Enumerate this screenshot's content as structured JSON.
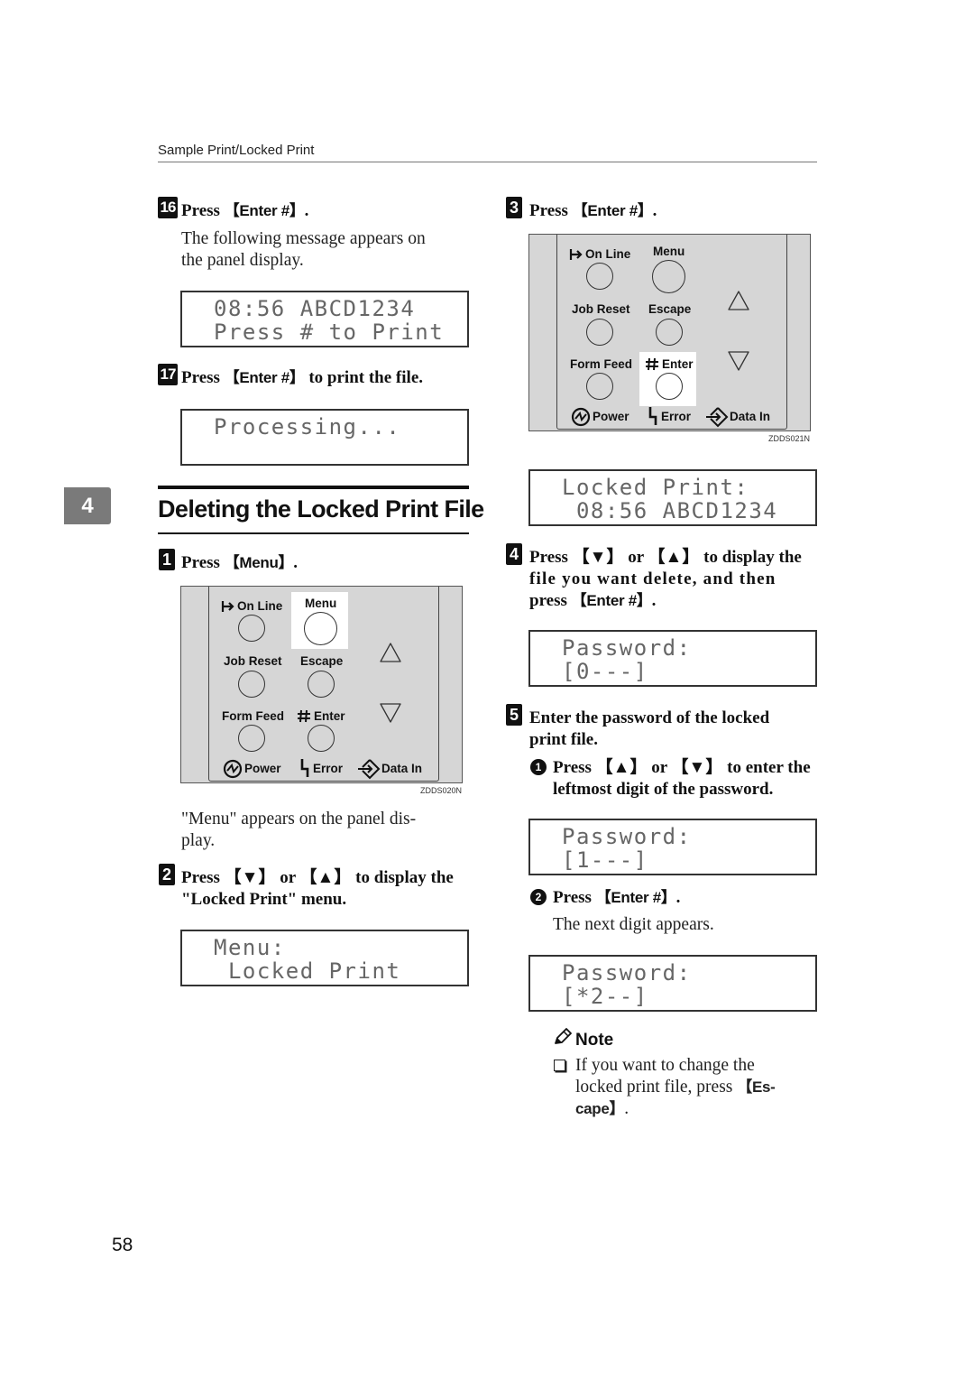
{
  "header": {
    "title": "Sample Print/Locked Print"
  },
  "chapter_tab": "4",
  "section_title": "Deleting the Locked Print File",
  "left_column": {
    "step16": {
      "number": "16",
      "prefix": "Press ",
      "key": "【Enter #】",
      "suffix": ".",
      "desc_line1": "The following message appears on",
      "desc_line2": "the panel display."
    },
    "lcd1": {
      "line1": "08:56 ABCD1234",
      "line2": "Press # to Print"
    },
    "step17": {
      "number": "17",
      "prefix": "Press ",
      "key": "【Enter #】",
      "suffix": " to print the file."
    },
    "lcd2": {
      "line1": "Processing...",
      "line2": ""
    },
    "step1": {
      "number": "1",
      "prefix": "Press ",
      "key": "【Menu】",
      "suffix": "."
    },
    "panel1": {
      "highlighted": "Menu",
      "ref": "ZDDS020N"
    },
    "step1_desc_line1": "\"Menu\" appears on the panel dis-",
    "step1_desc_line2": "play.",
    "step2": {
      "number": "2",
      "line1": "Press 【▼】 or 【▲】 to display the",
      "line2": "\"Locked Print\" menu."
    },
    "lcd3": {
      "line1": "Menu:",
      "line2": " Locked Print"
    }
  },
  "right_column": {
    "step3": {
      "number": "3",
      "prefix": "Press ",
      "key": "【Enter #】",
      "suffix": "."
    },
    "panel2": {
      "highlighted": "# Enter",
      "ref": "ZDDS021N"
    },
    "lcd4": {
      "line1": "Locked Print:",
      "line2": " 08:56 ABCD1234"
    },
    "step4": {
      "number": "4",
      "line1": "Press 【▼】 or 【▲】 to display the",
      "line2": "file you want delete, and then",
      "line3_prefix": "press ",
      "line3_key": "【Enter #】",
      "line3_suffix": "."
    },
    "lcd5": {
      "line1": "Password:",
      "line2": "[0---]"
    },
    "step5": {
      "number": "5",
      "line1": "Enter the password of the locked",
      "line2": "print file."
    },
    "sub1": {
      "number": "1",
      "line1": "Press 【▲】 or 【▼】 to enter the",
      "line2": "leftmost digit of the password."
    },
    "lcd6": {
      "line1": "Password:",
      "line2": "[1---]"
    },
    "sub2": {
      "number": "2",
      "prefix": "Press ",
      "key": "【Enter #】",
      "suffix": ".",
      "desc": "The next digit appears."
    },
    "lcd7": {
      "line1": "Password:",
      "line2": "[*2--]"
    },
    "note": {
      "title": "Note",
      "line1": "If you want to change the",
      "line2_prefix": "locked print file, press ",
      "line2_key": "【Es-",
      "line3_key": "cape】",
      "line3_suffix": "."
    }
  },
  "panel_labels": {
    "on_line": "On Line",
    "menu": "Menu",
    "job_reset": "Job Reset",
    "escape": "Escape",
    "form_feed": "Form Feed",
    "enter": "Enter",
    "power": "Power",
    "error": "Error",
    "data_in": "Data In"
  },
  "page_number": "58"
}
